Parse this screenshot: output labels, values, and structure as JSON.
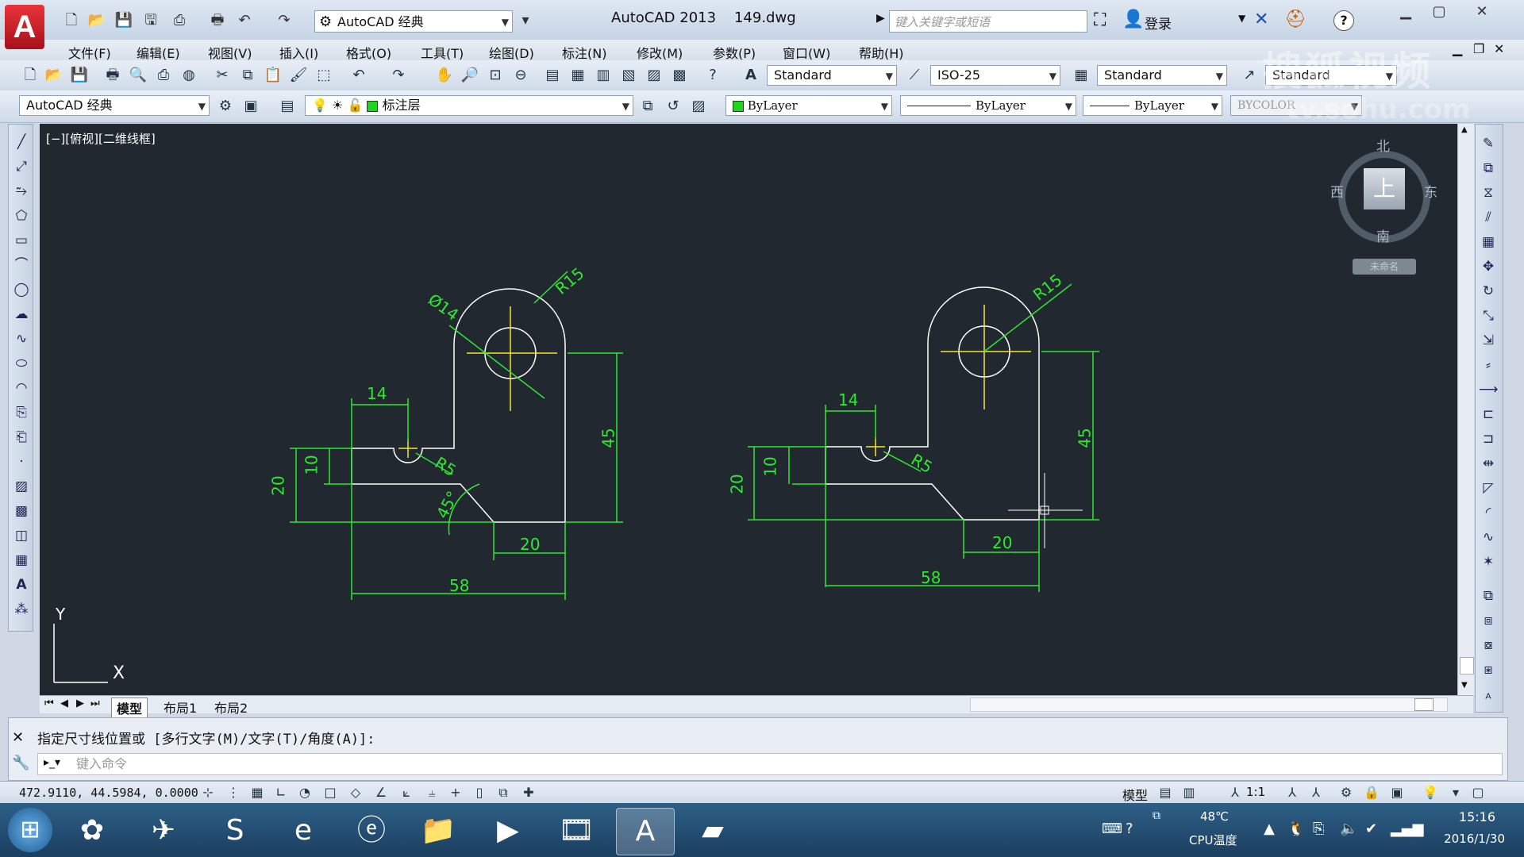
{
  "window": {
    "title": "AutoCAD 2013",
    "filename": "149.dwg",
    "search_placeholder": "键入关键字或短语",
    "login": "登录",
    "workspace": "AutoCAD 经典"
  },
  "menu": [
    "文件(F)",
    "编辑(E)",
    "视图(V)",
    "插入(I)",
    "格式(O)",
    "工具(T)",
    "绘图(D)",
    "标注(N)",
    "修改(M)",
    "参数(P)",
    "窗口(W)",
    "帮助(H)"
  ],
  "toolbar": {
    "text_style": "Standard",
    "dim_style": "ISO-25",
    "table_style": "Standard",
    "mleader_style": "Standard",
    "workspace2": "AutoCAD 经典",
    "layer": "标注层",
    "color": "ByLayer",
    "linetype": "ByLayer",
    "lineweight": "ByLayer",
    "plotstyle": "BYCOLOR"
  },
  "viewport": {
    "label": "[−][俯视][二维线框]",
    "viewcube": {
      "north": "北",
      "south": "南",
      "east": "东",
      "west": "西",
      "face": "上",
      "wcs": "未命名"
    },
    "ucs": {
      "x": "X",
      "y": "Y"
    }
  },
  "drawing": {
    "left": {
      "d1": "Ø14",
      "d2": "R15",
      "d3": "14",
      "d4": "10",
      "d5": "20",
      "d6": "R5",
      "d7": "45°",
      "d8": "45",
      "d9": "20",
      "d10": "58"
    },
    "right": {
      "d1": "R15",
      "d2": "14",
      "d3": "10",
      "d4": "20",
      "d5": "R5",
      "d6": "45",
      "d7": "20",
      "d8": "58"
    }
  },
  "tabs": [
    "模型",
    "布局1",
    "布局2"
  ],
  "command": {
    "history": "指定尺寸线位置或 [多行文字(M)/文字(T)/角度(A)]:",
    "input_placeholder": "键入命令"
  },
  "status": {
    "coords": "472.9110, 44.5984, 0.0000",
    "model": "模型",
    "scale": "1:1"
  },
  "taskbar": {
    "cpu_temp": "48℃",
    "cpu_label": "CPU温度",
    "time": "15:16",
    "date": "2016/1/30"
  },
  "watermark": {
    "line1": "搜狐视频",
    "line2": "tv.sohu.com"
  },
  "colors": {
    "canvas": "#212830",
    "geometry": "#ffffff",
    "dimension": "#2ee82e",
    "center": "#f2e62a"
  }
}
